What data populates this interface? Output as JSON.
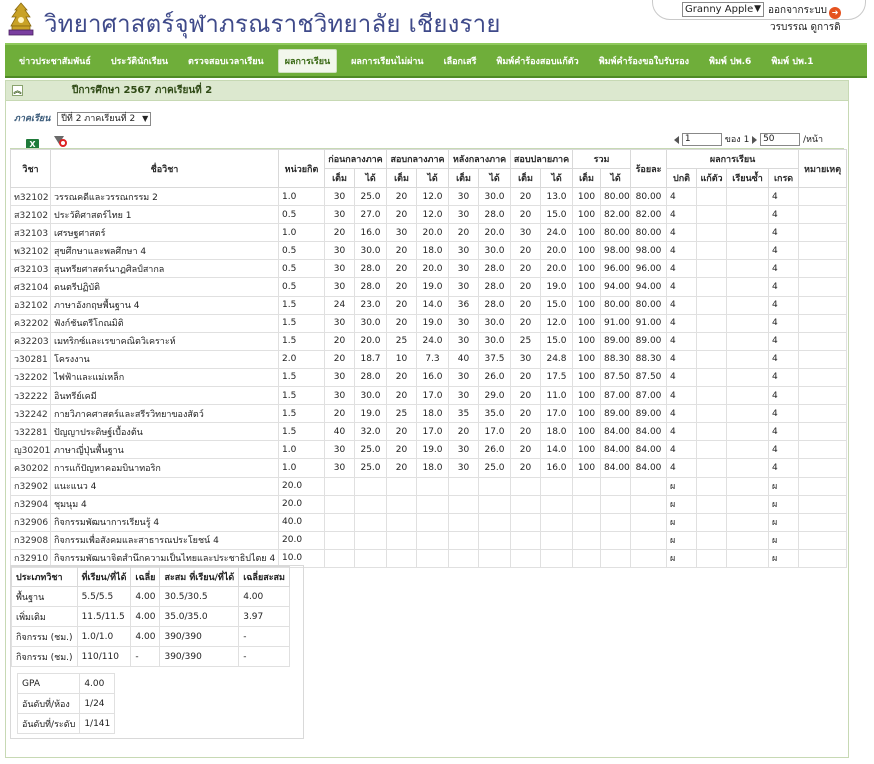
{
  "header": {
    "title": "วิทยาศาสตร์จุฬาภรณราชวิทยาลัย  เชียงราย",
    "theme": "Granny Apple",
    "logout_label": "ออกจากระบบ",
    "user_name": "วรบรรณ  ดูการดิ"
  },
  "nav": [
    {
      "label": "ข่าวประชาสัมพันธ์"
    },
    {
      "label": "ประวัตินักเรียน"
    },
    {
      "label": "ตรวจสอบเวลาเรียน"
    },
    {
      "label": "ผลการเรียน",
      "active": true
    },
    {
      "label": "ผลการเรียนไม่ผ่าน"
    },
    {
      "label": "เลือกเสรี"
    },
    {
      "label": "พิมพ์คำร้องสอบแก้ตัว"
    },
    {
      "label": "พิมพ์คำร้องขอใบรับรอง"
    },
    {
      "label": "พิมพ์ ปพ.6"
    },
    {
      "label": "พิมพ์ ปพ.1"
    }
  ],
  "panel": {
    "title": "ปีการศึกษา  2567  ภาคเรียนที่  2",
    "term_label": "ภาคเรียน",
    "term_value": "ปีที่ 2  ภาคเรียนที่ 2"
  },
  "pager": {
    "page_value": "1",
    "of_label": "ของ",
    "total": "1",
    "per_page_value": "50",
    "per_page_label": "/หน้า"
  },
  "table": {
    "headers": {
      "code": "วิชา",
      "name": "ชื่อวิชา",
      "credit": "หน่วยกิต",
      "pre_mid": "ก่อนกลางภาค",
      "mid": "สอบกลางภาค",
      "post_mid": "หลังกลางภาค",
      "final": "สอบปลายภาค",
      "total": "รวม",
      "percent": "ร้อยละ",
      "result": "ผลการเรียน",
      "note": "หมายเหตุ",
      "full": "เต็ม",
      "got": "ได้",
      "normal": "ปกติ",
      "fix": "แก้ตัว",
      "repeat": "เรียนซ้ำ",
      "grade": "เกรด"
    },
    "rows": [
      [
        "ท32102",
        "วรรณคดีและวรรณกรรม 2",
        "1.0",
        "30",
        "25.0",
        "20",
        "12.0",
        "30",
        "30.0",
        "20",
        "13.0",
        "100",
        "80.00",
        "80.00",
        "4",
        "",
        "",
        "4",
        ""
      ],
      [
        "ส32102",
        "ประวัติศาสตร์ไทย 1",
        "0.5",
        "30",
        "27.0",
        "20",
        "12.0",
        "30",
        "28.0",
        "20",
        "15.0",
        "100",
        "82.00",
        "82.00",
        "4",
        "",
        "",
        "4",
        ""
      ],
      [
        "ส32103",
        "เศรษฐศาสตร์",
        "1.0",
        "20",
        "16.0",
        "30",
        "20.0",
        "20",
        "20.0",
        "30",
        "24.0",
        "100",
        "80.00",
        "80.00",
        "4",
        "",
        "",
        "4",
        ""
      ],
      [
        "พ32102",
        "สุขศึกษาและพลศึกษา 4",
        "0.5",
        "30",
        "30.0",
        "20",
        "18.0",
        "30",
        "30.0",
        "20",
        "20.0",
        "100",
        "98.00",
        "98.00",
        "4",
        "",
        "",
        "4",
        ""
      ],
      [
        "ศ32103",
        "สุนทรียศาสตร์นาฏศิลป์สากล",
        "0.5",
        "30",
        "28.0",
        "20",
        "20.0",
        "30",
        "28.0",
        "20",
        "20.0",
        "100",
        "96.00",
        "96.00",
        "4",
        "",
        "",
        "4",
        ""
      ],
      [
        "ศ32104",
        "ดนตรีปฏิบัติ",
        "0.5",
        "30",
        "28.0",
        "20",
        "19.0",
        "30",
        "28.0",
        "20",
        "19.0",
        "100",
        "94.00",
        "94.00",
        "4",
        "",
        "",
        "4",
        ""
      ],
      [
        "อ32102",
        "ภาษาอังกฤษพื้นฐาน 4",
        "1.5",
        "24",
        "23.0",
        "20",
        "14.0",
        "36",
        "28.0",
        "20",
        "15.0",
        "100",
        "80.00",
        "80.00",
        "4",
        "",
        "",
        "4",
        ""
      ],
      [
        "ค32202",
        "ฟังก์ชันตรีโกณมิติ",
        "1.5",
        "30",
        "30.0",
        "20",
        "19.0",
        "30",
        "30.0",
        "20",
        "12.0",
        "100",
        "91.00",
        "91.00",
        "4",
        "",
        "",
        "4",
        ""
      ],
      [
        "ค32203",
        "เมทริกซ์และเรขาคณิตวิเคราะห์",
        "1.5",
        "20",
        "20.0",
        "25",
        "24.0",
        "30",
        "30.0",
        "25",
        "15.0",
        "100",
        "89.00",
        "89.00",
        "4",
        "",
        "",
        "4",
        ""
      ],
      [
        "ว30281",
        "โครงงาน",
        "2.0",
        "20",
        "18.7",
        "10",
        "7.3",
        "40",
        "37.5",
        "30",
        "24.8",
        "100",
        "88.30",
        "88.30",
        "4",
        "",
        "",
        "4",
        ""
      ],
      [
        "ว32202",
        "ไฟฟ้าและแม่เหล็ก",
        "1.5",
        "30",
        "28.0",
        "20",
        "16.0",
        "30",
        "26.0",
        "20",
        "17.5",
        "100",
        "87.50",
        "87.50",
        "4",
        "",
        "",
        "4",
        ""
      ],
      [
        "ว32222",
        "อินทรีย์เคมี",
        "1.5",
        "30",
        "30.0",
        "20",
        "17.0",
        "30",
        "29.0",
        "20",
        "11.0",
        "100",
        "87.00",
        "87.00",
        "4",
        "",
        "",
        "4",
        ""
      ],
      [
        "ว32242",
        "กายวิภาคศาสตร์และสรีรวิทยาของสัตว์",
        "1.5",
        "20",
        "19.0",
        "25",
        "18.0",
        "35",
        "35.0",
        "20",
        "17.0",
        "100",
        "89.00",
        "89.00",
        "4",
        "",
        "",
        "4",
        ""
      ],
      [
        "ว32281",
        "ปัญญาประดิษฐ์เบื้องต้น",
        "1.5",
        "40",
        "32.0",
        "20",
        "17.0",
        "20",
        "17.0",
        "20",
        "18.0",
        "100",
        "84.00",
        "84.00",
        "4",
        "",
        "",
        "4",
        ""
      ],
      [
        "ญ30201",
        "ภาษาญี่ปุ่นพื้นฐาน",
        "1.0",
        "30",
        "25.0",
        "20",
        "19.0",
        "30",
        "26.0",
        "20",
        "14.0",
        "100",
        "84.00",
        "84.00",
        "4",
        "",
        "",
        "4",
        ""
      ],
      [
        "ค30202",
        "การแก้ปัญหาคอมบินาทอริก",
        "1.0",
        "30",
        "25.0",
        "20",
        "18.0",
        "30",
        "25.0",
        "20",
        "16.0",
        "100",
        "84.00",
        "84.00",
        "4",
        "",
        "",
        "4",
        ""
      ],
      [
        "ก32902",
        "แนะแนว 4",
        "20.0",
        "",
        "",
        "",
        "",
        "",
        "",
        "",
        "",
        "",
        "",
        "",
        "ผ",
        "",
        "",
        "ผ",
        ""
      ],
      [
        "ก32904",
        "ชุมนุม 4",
        "20.0",
        "",
        "",
        "",
        "",
        "",
        "",
        "",
        "",
        "",
        "",
        "",
        "ผ",
        "",
        "",
        "ผ",
        ""
      ],
      [
        "ก32906",
        "กิจกรรมพัฒนาการเรียนรู้ 4",
        "40.0",
        "",
        "",
        "",
        "",
        "",
        "",
        "",
        "",
        "",
        "",
        "",
        "ผ",
        "",
        "",
        "ผ",
        ""
      ],
      [
        "ก32908",
        "กิจกรรมเพื่อสังคมและสาธารณประโยชน์ 4",
        "20.0",
        "",
        "",
        "",
        "",
        "",
        "",
        "",
        "",
        "",
        "",
        "",
        "ผ",
        "",
        "",
        "ผ",
        ""
      ],
      [
        "ก32910",
        "กิจกรรมพัฒนาจิตสำนึกความเป็นไทยและประชาธิปไตย 4",
        "10.0",
        "",
        "",
        "",
        "",
        "",
        "",
        "",
        "",
        "",
        "",
        "",
        "ผ",
        "",
        "",
        "ผ",
        ""
      ]
    ]
  },
  "summary": {
    "headers": [
      "ประเภทวิชา",
      "ที่เรียน/ที่ได้",
      "เฉลี่ย",
      "สะสม ที่เรียน/ที่ได้",
      "เฉลี่ยสะสม"
    ],
    "rows": [
      [
        "พื้นฐาน",
        "5.5/5.5",
        "4.00",
        "30.5/30.5",
        "4.00"
      ],
      [
        "เพิ่มเติม",
        "11.5/11.5",
        "4.00",
        "35.0/35.0",
        "3.97"
      ],
      [
        "กิจกรรม (ชม.)",
        "1.0/1.0",
        "4.00",
        "390/390",
        "-"
      ],
      [
        "กิจกรรม (ชม.)",
        "110/110",
        "-",
        "390/390",
        "-"
      ]
    ],
    "gpa_label": "GPA",
    "gpa": "4.00",
    "rank_room_label": "อันดับที่/ห้อง",
    "rank_room": "1/24",
    "rank_level_label": "อันดับที่/ระดับ",
    "rank_level": "1/141"
  }
}
